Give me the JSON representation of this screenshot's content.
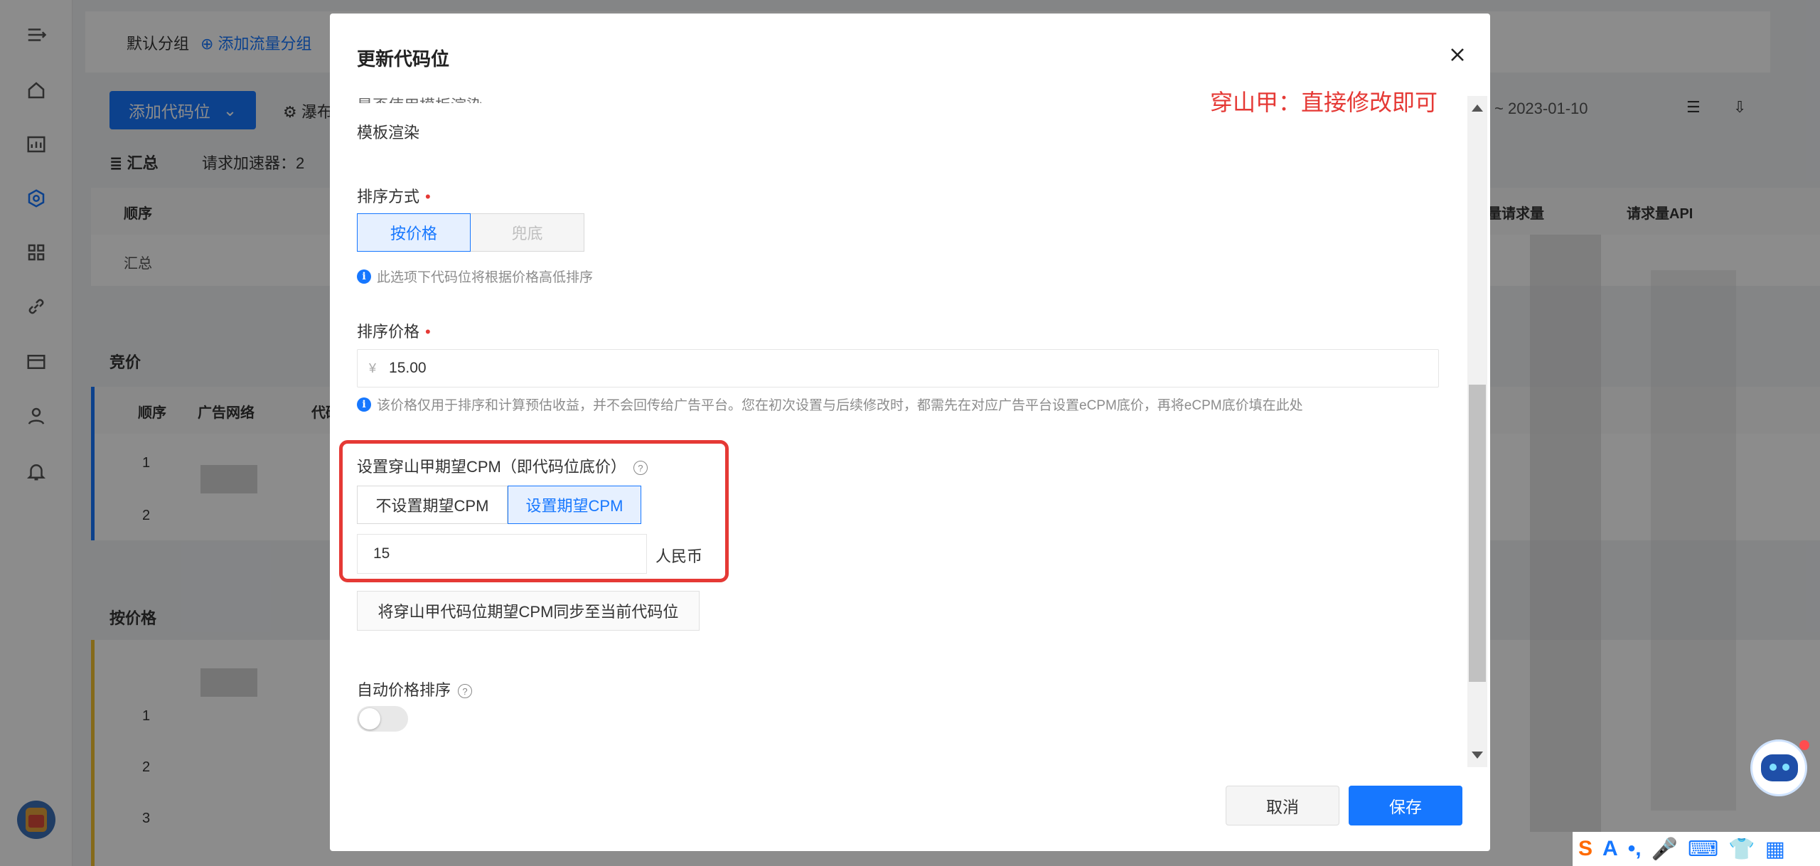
{
  "background": {
    "group_default": "默认分组",
    "add_traffic_group": "添加流量分组",
    "add_slot_button": "添加代码位",
    "waterfall_partial": "瀑布",
    "date_range_end": "~ 2023-01-10",
    "summary_label": "汇总",
    "accelerator_label": "请求加速器：2",
    "columns_top": [
      "顺序",
      "量请求量",
      "请求量API"
    ],
    "summary_row": "汇总",
    "bidding_section": "竞价",
    "bidding_columns": [
      "顺序",
      "广告网络",
      "代码"
    ],
    "bidding_rows": [
      "1",
      "2"
    ],
    "price_section": "按价格",
    "price_rows": [
      "1",
      "2",
      "3"
    ]
  },
  "modal": {
    "title": "更新代码位",
    "annotation": "穿山甲：直接修改即可",
    "template_render_label_partial": "是否使用模板渲染",
    "template_render_value": "模板渲染",
    "sort_method": {
      "label": "排序方式",
      "options": [
        "按价格",
        "兜底"
      ],
      "hint": "此选项下代码位将根据价格高低排序"
    },
    "sort_price": {
      "label": "排序价格",
      "currency_symbol": "¥",
      "value": "15.00",
      "hint": "该价格仅用于排序和计算预估收益，并不会回传给广告平台。您在初次设置与后续修改时，都需先在对应广告平台设置eCPM底价，再将eCPM底价填在此处"
    },
    "expected_cpm": {
      "label": "设置穿山甲期望CPM（即代码位底价）",
      "options": [
        "不设置期望CPM",
        "设置期望CPM"
      ],
      "value": "15",
      "unit": "人民币",
      "sync_button": "将穿山甲代码位期望CPM同步至当前代码位"
    },
    "auto_sort": {
      "label": "自动价格排序",
      "enabled": false
    },
    "cancel_button": "取消",
    "save_button": "保存"
  },
  "colors": {
    "primary": "#1677ff",
    "annotation_red": "#e53935"
  }
}
